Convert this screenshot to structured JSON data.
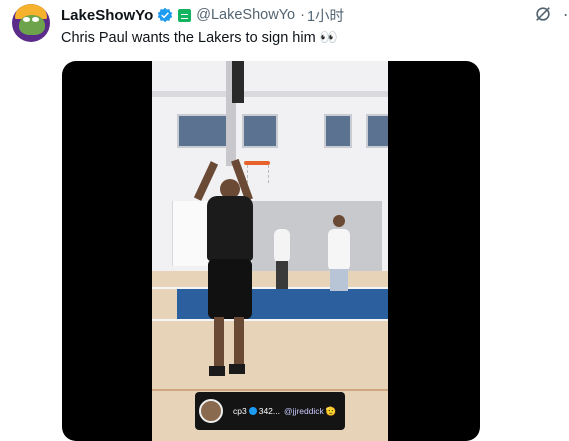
{
  "tweet": {
    "display_name": "LakeShowYo",
    "handle": "@LakeShowYo",
    "separator": "·",
    "time": "1小时",
    "text": "Chris Paul wants the Lakers to sign him 👀"
  },
  "media": {
    "overlay": {
      "user": "cp3",
      "count": "342...",
      "mention": "@jjreddick",
      "emoji": "🫡"
    }
  },
  "icons": {
    "verified": "verified-badge-icon",
    "affiliate": "affiliate-badge-icon",
    "grok": "grok-icon",
    "more": "more-icon"
  },
  "colors": {
    "verified_blue": "#1d9bf0",
    "handle_gray": "#536471",
    "text": "#0f1419"
  }
}
